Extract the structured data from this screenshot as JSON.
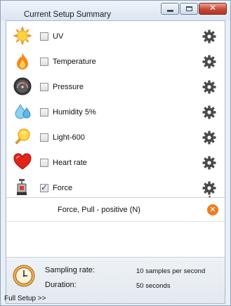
{
  "window": {
    "title": "Current Setup Summary",
    "controls": [
      "minimize",
      "maximize",
      "close"
    ]
  },
  "sensors": [
    {
      "label": "UV",
      "checked": false,
      "icon": "sun-icon"
    },
    {
      "label": "Temperature",
      "checked": false,
      "icon": "flame-icon"
    },
    {
      "label": "Pressure",
      "checked": false,
      "icon": "gauge-icon"
    },
    {
      "label": "Humidity 5%",
      "checked": false,
      "icon": "water-drops-icon"
    },
    {
      "label": "Light-600",
      "checked": false,
      "icon": "light-bulb-icon"
    },
    {
      "label": "Heart rate",
      "checked": false,
      "icon": "heart-icon"
    },
    {
      "label": "Force",
      "checked": true,
      "icon": "force-sensor-icon",
      "gear_badge": "1"
    }
  ],
  "channels": [
    {
      "label": "Force, Pull - positive (N)"
    }
  ],
  "footer": {
    "sampling_label": "Sampling rate:",
    "sampling_value": "10 samples per second",
    "duration_label": "Duration:",
    "duration_value": "50 seconds"
  },
  "full_setup_link": "Full Setup >>",
  "colors": {
    "accent_orange": "#f07d22",
    "checkbox_check": "#1c3f7a",
    "close_red": "#c94634"
  }
}
